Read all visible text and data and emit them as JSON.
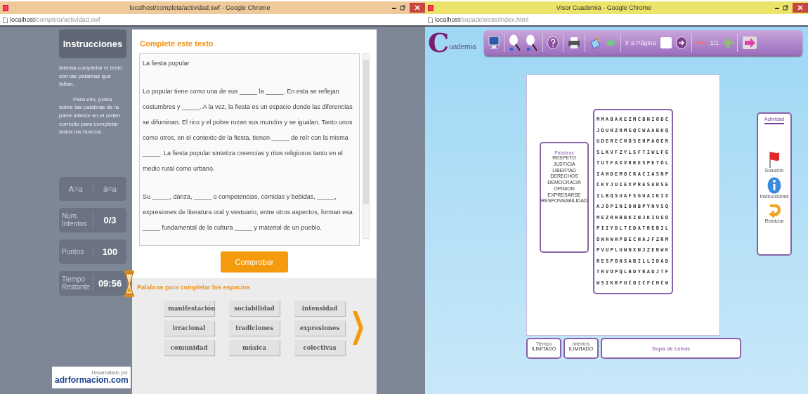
{
  "left_window": {
    "title": "localhost/completa/actividad.swf - Google Chrome",
    "address": {
      "host": "localhost",
      "path": "/completa/actividad.swf"
    },
    "sidebar": {
      "heading": "Instrucciones",
      "instructions": [
        "Intenta completar el texto con las palabras que faltan.",
        "Para ello, pulsa sobre las palabras de la parte inferior en el orden correcto para completar todos los huecos."
      ],
      "case_toggles": [
        "A=a",
        "á=a"
      ],
      "stats": [
        {
          "label": "Num. Intentos",
          "value": "0/3"
        },
        {
          "label": "Puntos",
          "value": "100"
        },
        {
          "label": "Tiempo Restante",
          "value": "09:56"
        }
      ],
      "credit": {
        "caption": "Desarrollado por",
        "brand": "adrformacion.com"
      }
    },
    "main": {
      "heading": "Complete este texto",
      "paragraphs": [
        "La fiesta popular",
        "Lo popular tiene como una de sus _____ la _____. En esta se reflejan costumbres y _____. A la vez, la fiesta es un espacio donde las diferencias se difuminan. El rico y el pobre rozan sus mundos y se igualan. Tanto unos como otros, en el contexto de la fiesta, tienen _____ de reír con la misma _____. La fiesta popular sintetiza creencias y ritos religiosos tanto en el medio rural como urbano.",
        "Su _____, danza, _____ o competencias, comidas y bebidas, _____, expresiones de literatura oral y vestuario, entre otros aspectos, forman esa _____ fundamental de la cultura _____ y material de un pueblo."
      ],
      "check_button": "Comprobar",
      "words_heading": "Palabras para completar los espacios",
      "words": [
        "manifestación",
        "sociabilidad",
        "intensidad",
        "irracional",
        "tradiciones",
        "expresiones",
        "comunidad",
        "música",
        "colectivas"
      ]
    }
  },
  "right_window": {
    "title": "Visor Cuademia - Google Chrome",
    "address": {
      "host": "localhost",
      "path": "/sopadeletras/index.html"
    },
    "logo": {
      "initial": "C",
      "rest": "uademia"
    },
    "toolbar": {
      "goto_label": "Ir a Página",
      "page_count": "1/1"
    },
    "word_list": {
      "heading": "Palabras",
      "words": [
        "RESPETO",
        "JUSTICIA",
        "LIBERTAD",
        "DERECHOS",
        "DEMOCRACIA",
        "OPINION",
        "EXPRESARSE",
        "RESPONSABILIDAD"
      ]
    },
    "grid": [
      "MMABAKEZMCBNIODC",
      "JDUHZRMGQCWAABKQ",
      "UDERECHOSEHPAQER",
      "SLKVFZYLSFTIWLFG",
      "TUTFAXVRRESPETOL",
      "IAHDEMOCRACIASNP",
      "CKYJUIEXPRESARSE",
      "ILBQSUAFSGUAIKIX",
      "AJOPINIONBPYNVSQ",
      "MEZRHBBKZNJKIUGO",
      "PIIYDLTEDATREBIL",
      "OWHWHPBECHAJFZRM",
      "PVUPLUWNXNJZEBWK",
      "RESPONSABILLIDAD",
      "TRVOPQLBDYRADJTF",
      "WSIKBFUCOICFCHCW"
    ],
    "activity": {
      "heading": "Actividad",
      "items": [
        {
          "kind": "flag",
          "label": "Solución"
        },
        {
          "kind": "info",
          "label": "Instrucciones"
        },
        {
          "kind": "undo",
          "label": "Reiniciar"
        }
      ]
    },
    "footer": {
      "stats": [
        {
          "label": "Tiempo",
          "value": "ILIMITADO"
        },
        {
          "label": "Intentos",
          "value": "ILIMITADO"
        }
      ],
      "title": "Sopa de Letras"
    }
  }
}
